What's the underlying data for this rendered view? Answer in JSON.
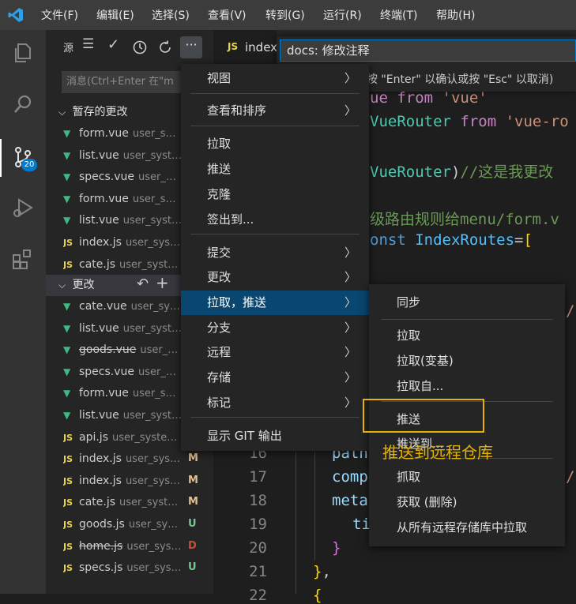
{
  "menubar": [
    "文件(F)",
    "编辑(E)",
    "选择(S)",
    "查看(V)",
    "转到(G)",
    "运行(R)",
    "终端(T)",
    "帮助(H)"
  ],
  "activity": {
    "scm_badge": "20"
  },
  "sidebar": {
    "title": "源",
    "commit_placeholder": "消息(Ctrl+Enter 在\"m",
    "staged_header": "暂存的更改",
    "changes_header": "更改",
    "staged": [
      {
        "type": "vue",
        "name": "form.vue",
        "path": "user_s…",
        "status": ""
      },
      {
        "type": "vue",
        "name": "list.vue",
        "path": "user_syst…",
        "status": ""
      },
      {
        "type": "vue",
        "name": "specs.vue",
        "path": "user_…",
        "status": ""
      },
      {
        "type": "vue",
        "name": "form.vue",
        "path": "user_s…",
        "status": ""
      },
      {
        "type": "vue",
        "name": "list.vue",
        "path": "user_syst…",
        "status": ""
      },
      {
        "type": "js",
        "name": "index.js",
        "path": "user_sys…",
        "status": ""
      },
      {
        "type": "js",
        "name": "cate.js",
        "path": "user_syst…",
        "status": ""
      }
    ],
    "changes": [
      {
        "type": "vue",
        "name": "cate.vue",
        "path": "user_sy…",
        "status": "",
        "strike": false
      },
      {
        "type": "vue",
        "name": "list.vue",
        "path": "user_syst…",
        "status": "",
        "strike": false
      },
      {
        "type": "vue",
        "name": "goods.vue",
        "path": "user_…",
        "status": "",
        "strike": true
      },
      {
        "type": "vue",
        "name": "specs.vue",
        "path": "user_…",
        "status": "",
        "strike": false
      },
      {
        "type": "vue",
        "name": "form.vue",
        "path": "user_s…",
        "status": "",
        "strike": false
      },
      {
        "type": "vue",
        "name": "list.vue",
        "path": "user_syst…",
        "status": "",
        "strike": false
      },
      {
        "type": "js",
        "name": "api.js",
        "path": "user_syste…",
        "status": "",
        "strike": false
      },
      {
        "type": "js",
        "name": "index.js",
        "path": "user_sys…",
        "status": "M",
        "strike": false
      },
      {
        "type": "js",
        "name": "index.js",
        "path": "user_sys…",
        "status": "M",
        "strike": false
      },
      {
        "type": "js",
        "name": "cate.js",
        "path": "user_syst…",
        "status": "M",
        "strike": false
      },
      {
        "type": "js",
        "name": "goods.js",
        "path": "user_sy…",
        "status": "U",
        "strike": false
      },
      {
        "type": "js",
        "name": "home.js",
        "path": "user_sys…",
        "status": "D",
        "strike": true
      },
      {
        "type": "js",
        "name": "specs.js",
        "path": "user_sys…",
        "status": "U",
        "strike": false
      }
    ]
  },
  "editor": {
    "tab_label": "index",
    "tab_icon": "JS",
    "line_numbers": [
      "16",
      "17",
      "18",
      "19",
      "20",
      "21",
      "22"
    ]
  },
  "quick_input": {
    "value": "docs: 修改注释",
    "message": "息 (按 \"Enter\" 以确认或按 \"Esc\" 以取消)"
  },
  "menu_main": {
    "items": [
      {
        "label": "视图",
        "submenu": true
      },
      {
        "label": "查看和排序",
        "submenu": true
      },
      {
        "label": "拉取",
        "submenu": false
      },
      {
        "label": "推送",
        "submenu": false
      },
      {
        "label": "克隆",
        "submenu": false
      },
      {
        "label": "签出到...",
        "submenu": false
      },
      {
        "label": "提交",
        "submenu": true
      },
      {
        "label": "更改",
        "submenu": true
      },
      {
        "label": "拉取，推送",
        "submenu": true
      },
      {
        "label": "分支",
        "submenu": true
      },
      {
        "label": "远程",
        "submenu": true
      },
      {
        "label": "存储",
        "submenu": true
      },
      {
        "label": "标记",
        "submenu": true
      },
      {
        "label": "显示 GIT 输出",
        "submenu": false
      }
    ]
  },
  "menu_sub": {
    "items": [
      "同步",
      "拉取",
      "拉取(变基)",
      "拉取自...",
      "推送",
      "推送到...",
      "抓取",
      "获取 (删除)",
      "从所有远程存储库中拉取"
    ]
  },
  "annotation": "推送到远程仓库",
  "colors": {
    "accent": "#007acc",
    "highlight": "#e5b400",
    "modified": "#e2c08d",
    "untracked": "#73c991",
    "deleted": "#c74e39"
  }
}
